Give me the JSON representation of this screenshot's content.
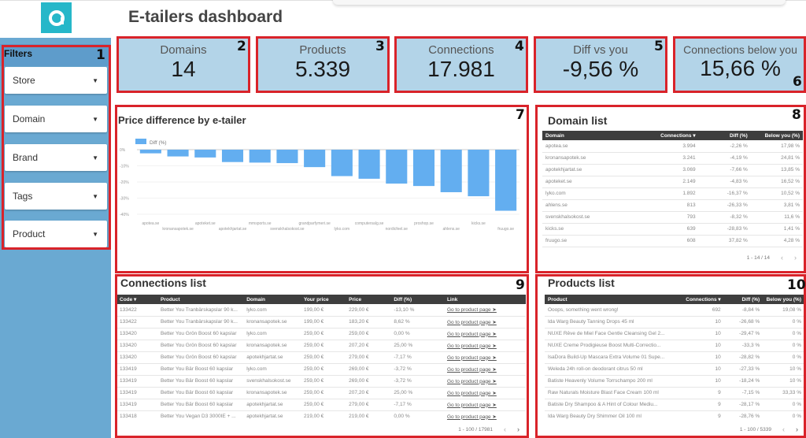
{
  "header": {
    "title": "E-tailers dashboard",
    "logo_icon": "brand-logo-icon"
  },
  "annotations": [
    "1",
    "2",
    "3",
    "4",
    "5",
    "6",
    "7",
    "8",
    "9",
    "10"
  ],
  "filters": {
    "title": "Filters",
    "items": [
      {
        "label": "Store"
      },
      {
        "label": "Domain"
      },
      {
        "label": "Brand"
      },
      {
        "label": "Tags"
      },
      {
        "label": "Product"
      }
    ]
  },
  "kpis": [
    {
      "label": "Domains",
      "value": "14"
    },
    {
      "label": "Products",
      "value": "5.339"
    },
    {
      "label": "Connections",
      "value": "17.981"
    },
    {
      "label": "Diff vs you",
      "value": "-9,56 %"
    },
    {
      "label": "Connections below you",
      "value": "15,66 %"
    }
  ],
  "chart_data": {
    "type": "bar",
    "title": "Price difference by e-tailer",
    "legend": [
      "Diff (%)"
    ],
    "legend_position": "top-left",
    "categories": [
      "apotea.se",
      "kronansapotek.se",
      "apoteket.se",
      "apotekhjartat.se",
      "mmsports.se",
      "svenskhalsokost.se",
      "grandparfymeri.se",
      "lyko.com",
      "computersalg.se",
      "nordicfeel.se",
      "proshop.se",
      "ahlens.se",
      "kicks.se",
      "fruugo.se"
    ],
    "series": [
      {
        "name": "Diff (%)",
        "values": [
          -2.26,
          -4.19,
          -4.83,
          -7.66,
          -8.0,
          -8.32,
          -10.8,
          -16.37,
          -18.0,
          -21.0,
          -22.5,
          -26.33,
          -28.83,
          -37.82
        ]
      }
    ],
    "yticks": [
      "0%",
      "-10%",
      "-20%",
      "-30%",
      "-40%"
    ],
    "ylim": [
      -40,
      0
    ],
    "grid": true,
    "color": "#63aef0"
  },
  "domain_list": {
    "title": "Domain list",
    "columns": [
      "Domain",
      "Connections ▾",
      "Diff (%)",
      "Below you (%)"
    ],
    "rows": [
      [
        "apotea.se",
        "3.994",
        "-2,26 %",
        "17,98 %"
      ],
      [
        "kronansapotek.se",
        "3.241",
        "-4,19 %",
        "24,81 %"
      ],
      [
        "apotekhjartat.se",
        "3.069",
        "-7,66 %",
        "13,85 %"
      ],
      [
        "apoteket.se",
        "2.149",
        "-4,83 %",
        "16,52 %"
      ],
      [
        "lyko.com",
        "1.892",
        "-16,37 %",
        "10,52 %"
      ],
      [
        "ahlens.se",
        "813",
        "-26,33 %",
        "3,81 %"
      ],
      [
        "svenskhalsokost.se",
        "793",
        "-8,32 %",
        "11,6 %"
      ],
      [
        "kicks.se",
        "639",
        "-28,83 %",
        "1,41 %"
      ],
      [
        "fruugo.se",
        "608",
        "37,82 %",
        "4,28 %"
      ]
    ],
    "pager": "1 - 14 / 14"
  },
  "connections_list": {
    "title": "Connections list",
    "columns": [
      "Code ▾",
      "Product",
      "Domain",
      "Your price",
      "Price",
      "Diff (%)",
      "Link"
    ],
    "rows": [
      [
        "133422",
        "Better You Tranbärskapslar 90 k...",
        "lyko.com",
        "199,00 €",
        "229,00 €",
        "-13,10 %",
        "Go to product page ➤"
      ],
      [
        "133422",
        "Better You Tranbärskapslar 90 k...",
        "kronansapotek.se",
        "199,00 €",
        "183,20 €",
        "8,62 %",
        "Go to product page ➤"
      ],
      [
        "133420",
        "Better You Grön Boost 60 kapslar",
        "lyko.com",
        "259,00 €",
        "259,00 €",
        "0,00 %",
        "Go to product page ➤"
      ],
      [
        "133420",
        "Better You Grön Boost 60 kapslar",
        "kronansapotek.se",
        "259,00 €",
        "207,20 €",
        "25,00 %",
        "Go to product page ➤"
      ],
      [
        "133420",
        "Better You Grön Boost 60 kapslar",
        "apotekhjartat.se",
        "259,00 €",
        "279,00 €",
        "-7,17 %",
        "Go to product page ➤"
      ],
      [
        "133419",
        "Better You Bär Boost 60 kapslar",
        "lyko.com",
        "259,00 €",
        "269,00 €",
        "-3,72 %",
        "Go to product page ➤"
      ],
      [
        "133419",
        "Better You Bär Boost 60 kapslar",
        "svenskhalsokost.se",
        "259,00 €",
        "269,00 €",
        "-3,72 %",
        "Go to product page ➤"
      ],
      [
        "133419",
        "Better You Bär Boost 60 kapslar",
        "kronansapotek.se",
        "259,00 €",
        "207,20 €",
        "25,00 %",
        "Go to product page ➤"
      ],
      [
        "133419",
        "Better You Bär Boost 60 kapslar",
        "apotekhjartat.se",
        "259,00 €",
        "279,00 €",
        "-7,17 %",
        "Go to product page ➤"
      ],
      [
        "133418",
        "Better You Vegan D3 3000IE + ...",
        "apotekhjartat.se",
        "219,00 €",
        "219,00 €",
        "0,00 %",
        "Go to product page ➤"
      ]
    ],
    "pager": "1 - 100 / 17981"
  },
  "products_list": {
    "title": "Products list",
    "columns": [
      "Product",
      "Connections ▾",
      "Diff (%)",
      "Below you (%)"
    ],
    "rows": [
      [
        "Ooops, something went wrong!",
        "692",
        "-8,84 %",
        "19,08 %"
      ],
      [
        "Ida Warg Beauty Tanning Drops 45 ml",
        "10",
        "-26,68 %",
        "0 %"
      ],
      [
        "NUXE Rêve de Miel Face Gentle Cleansing Gel 2...",
        "10",
        "-29,47 %",
        "0 %"
      ],
      [
        "NUXE Creme Prodigieuse Boost Multi-Correctio...",
        "10",
        "-33,3 %",
        "0 %"
      ],
      [
        "IsaDora Build-Up Mascara Extra Volume 01 Supe...",
        "10",
        "-28,82 %",
        "0 %"
      ],
      [
        "Weleda 24h roll-on deodorant citrus 50 ml",
        "10",
        "-27,33 %",
        "10 %"
      ],
      [
        "Batiste Heavenly Volume Torrschampo 200 ml",
        "10",
        "-18,24 %",
        "10 %"
      ],
      [
        "Raw Naturals Moisture Blast Face Cream 100 ml",
        "9",
        "-7,15 %",
        "33,33 %"
      ],
      [
        "Batiste Dry Shampoo & A Hint of Colour Mediu...",
        "9",
        "-28,17 %",
        "0 %"
      ],
      [
        "Ida Warg Beauty Dry Shimmer Oil 100 ml",
        "9",
        "-28,76 %",
        "0 %"
      ]
    ],
    "pager": "1 - 100 / 5339"
  },
  "pager_icons": {
    "prev": "‹",
    "next": "›"
  }
}
